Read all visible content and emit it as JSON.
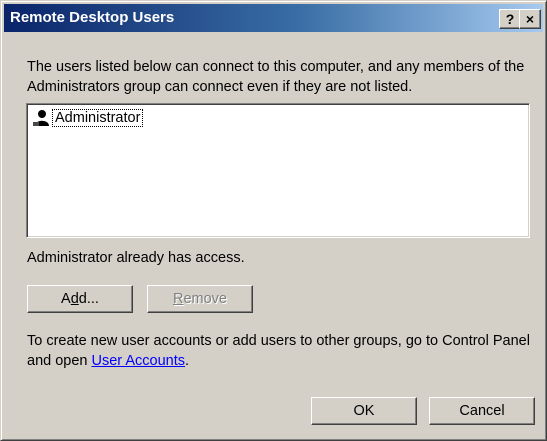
{
  "window": {
    "title": "Remote Desktop Users",
    "help_label": "?",
    "close_label": "×"
  },
  "intro_text": "The users listed below can connect to this computer, and any members of the Administrators group can connect even if they are not listed.",
  "users_list": {
    "items": [
      {
        "name": "Administrator",
        "icon": "user-icon"
      }
    ]
  },
  "status_text": "Administrator already has access.",
  "buttons": {
    "add": {
      "prefix": "A",
      "mnemonic": "d",
      "suffix": "d..."
    },
    "remove": {
      "prefix": "",
      "mnemonic": "R",
      "suffix": "emove",
      "enabled": false
    },
    "ok": "OK",
    "cancel": "Cancel"
  },
  "footer": {
    "text": "To create new user accounts or add users to other groups, go to Control Panel and open ",
    "link": "User Accounts",
    "end": "."
  }
}
